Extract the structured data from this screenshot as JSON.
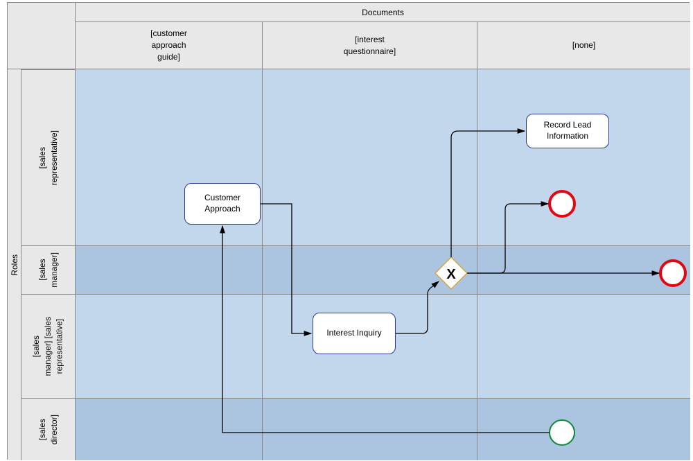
{
  "swimlane": {
    "colGroupTitle": "Documents",
    "rowGroupTitle": "Roles",
    "columns": {
      "col1": "[customer\napproach\nguide]",
      "col2": "[interest\nquestionnaire]",
      "col3": "[none]"
    },
    "rows": {
      "row1": "[sales\nrepresentative]",
      "row2": "[sales\nmanager]",
      "row3": "[sales\nmanager] [sales\nrepresentative]",
      "row4": "[sales\ndirector]"
    }
  },
  "tasks": {
    "customerApproach": "Customer\nApproach",
    "interestInquiry": "Interest Inquiry",
    "recordLead": "Record Lead\nInformation"
  },
  "events": {
    "start": {
      "type": "start",
      "borderColor": "#0a8a3a"
    },
    "end1": {
      "type": "end",
      "borderColor": "#e30613"
    },
    "end2": {
      "type": "end",
      "borderColor": "#e30613"
    }
  },
  "gateway": {
    "type": "exclusive",
    "marker": "X"
  }
}
